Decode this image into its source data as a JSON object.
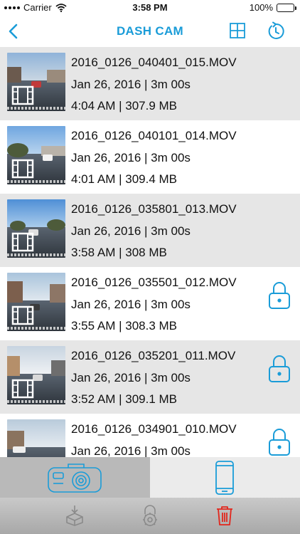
{
  "status_bar": {
    "carrier": "Carrier",
    "time": "3:58 PM",
    "battery": "100%"
  },
  "nav": {
    "title": "DASH CAM",
    "back_icon": "chevron-left-icon",
    "grid_icon": "grid-icon",
    "history_icon": "history-icon"
  },
  "colors": {
    "accent": "#1a9cd8",
    "row_shaded": "#e6e6e6",
    "delete": "#e2261c",
    "icon_gray": "#8a8a8a"
  },
  "files": [
    {
      "name": "2016_0126_040401_015.MOV",
      "date": "Jan 26, 2016 |  3m 00s",
      "meta": "4:04 AM | 307.9 MB",
      "locked": false
    },
    {
      "name": "2016_0126_040101_014.MOV",
      "date": "Jan 26, 2016 |  3m 00s",
      "meta": "4:01 AM | 309.4 MB",
      "locked": false
    },
    {
      "name": "2016_0126_035801_013.MOV",
      "date": "Jan 26, 2016 |  3m 00s",
      "meta": "3:58 AM | 308 MB",
      "locked": false
    },
    {
      "name": "2016_0126_035501_012.MOV",
      "date": "Jan 26, 2016 |  3m 00s",
      "meta": "3:55 AM | 308.3 MB",
      "locked": true
    },
    {
      "name": "2016_0126_035201_011.MOV",
      "date": "Jan 26, 2016 |  3m 00s",
      "meta": "3:52 AM | 309.1 MB",
      "locked": true
    },
    {
      "name": "2016_0126_034901_010.MOV",
      "date": "Jan 26, 2016 |  3m 00s",
      "meta": "",
      "locked": true
    }
  ],
  "source_tabs": [
    {
      "icon": "dash-camera-icon",
      "selected": false
    },
    {
      "icon": "phone-icon",
      "selected": true
    }
  ],
  "actions": [
    {
      "icon": "download-box-icon"
    },
    {
      "icon": "lock-gear-icon"
    },
    {
      "icon": "trash-icon"
    }
  ]
}
